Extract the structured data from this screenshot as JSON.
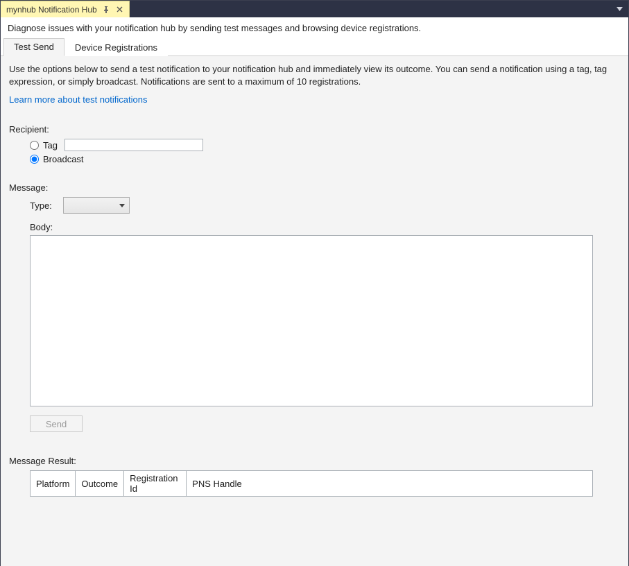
{
  "tab": {
    "title": "mynhub Notification Hub"
  },
  "diagnose_description": "Diagnose issues with your notification hub by sending test messages and browsing device registrations.",
  "inner_tabs": {
    "test_send": "Test Send",
    "device_registrations": "Device Registrations"
  },
  "intro_text": "Use the options below to send a test notification to your notification hub and immediately view its outcome. You can send a notification using a tag, tag expression, or simply broadcast. Notifications are sent to a maximum of 10 registrations.",
  "learn_more": "Learn more about test notifications",
  "recipient": {
    "label": "Recipient:",
    "tag_label": "Tag",
    "tag_value": "",
    "broadcast_label": "Broadcast"
  },
  "message": {
    "label": "Message:",
    "type_label": "Type:",
    "type_value": "",
    "body_label": "Body:",
    "body_value": "",
    "send_label": "Send"
  },
  "result": {
    "label": "Message Result:",
    "columns": {
      "platform": "Platform",
      "outcome": "Outcome",
      "registration_id": "Registration Id",
      "pns_handle": "PNS Handle"
    }
  }
}
